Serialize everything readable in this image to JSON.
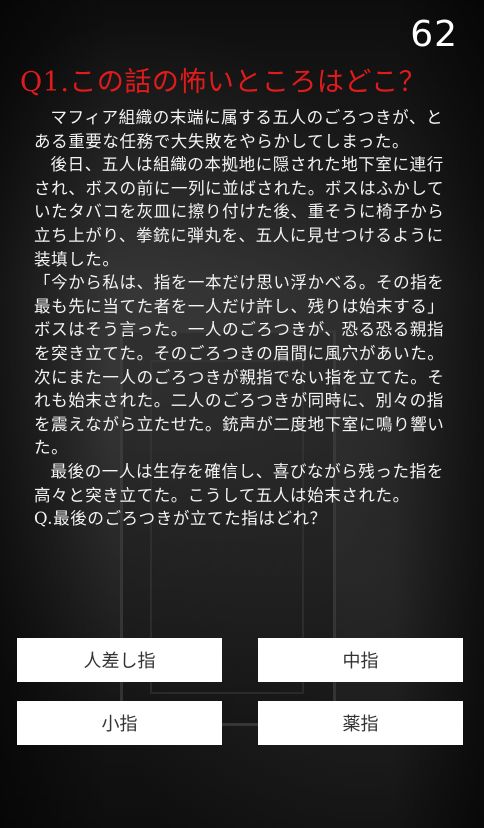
{
  "counter": "62",
  "question_title": "Q1.この話の怖いところはどこ？",
  "story_paragraphs": [
    "マフィア組織の末端に属する五人のごろつきが、とある重要な任務で大失敗をやらかしてしまった。",
    "後日、五人は組織の本拠地に隠された地下室に連行され、ボスの前に一列に並ばされた。ボスはふかしていたタバコを灰皿に擦り付けた後、重そうに椅子から立ち上がり、拳銃に弾丸を、五人に見せつけるように装填した。",
    "「今から私は、指を一本だけ思い浮かべる。その指を最も先に当てた者を一人だけ許し、残りは始末する」ボスはそう言った。一人のごろつきが、恐る恐る親指を突き立てた。そのごろつきの眉間に風穴があいた。次にまた一人のごろつきが親指でない指を立てた。それも始末された。二人のごろつきが同時に、別々の指を震えながら立たせた。銃声が二度地下室に鳴り響いた。",
    "最後の一人は生存を確信し、喜びながら残った指を高々と突き立てた。こうして五人は始末された。"
  ],
  "final_question": "Q.最後のごろつきが立てた指はどれ？",
  "answers": [
    "人差し指",
    "中指",
    "小指",
    "薬指"
  ]
}
